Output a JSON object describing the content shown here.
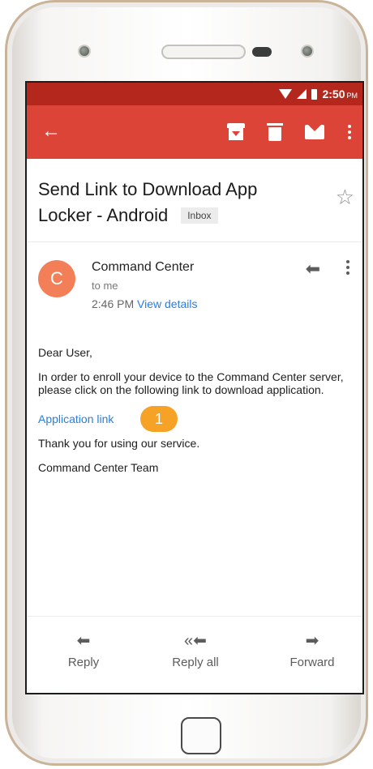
{
  "status_bar": {
    "time": "2:50",
    "ampm": "PM"
  },
  "email": {
    "subject": "Send Link to Download App Locker - Android",
    "label": "Inbox",
    "sender": {
      "initial": "C",
      "name": "Command Center",
      "to": "to me",
      "time": "2:46 PM",
      "details_link": "View details"
    },
    "body": {
      "greeting": "Dear User,",
      "paragraph": "In order to enroll your device to the Command Center server, please click on the following link to download application.",
      "link_text": "Application link",
      "thanks": "Thank you for using our service.",
      "signature": "Command Center Team"
    }
  },
  "callout_number": "1",
  "footer": {
    "reply": "Reply",
    "reply_all": "Reply all",
    "forward": "Forward"
  },
  "colors": {
    "status_bar": "#b4271d",
    "app_bar": "#db4437",
    "avatar": "#f37f59",
    "link": "#2a7de1",
    "callout": "#f5a226"
  }
}
